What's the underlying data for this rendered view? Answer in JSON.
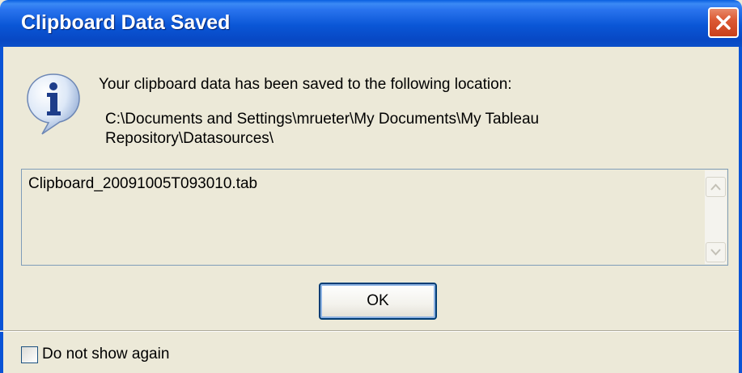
{
  "window": {
    "title": "Clipboard Data Saved",
    "close_icon": "close-icon"
  },
  "dialog": {
    "icon": "info-icon",
    "message": "Your clipboard data has been saved to the following location:",
    "path_line1": "C:\\Documents and Settings\\mrueter\\My Documents\\My Tableau",
    "path_line2": "Repository\\Datasources\\",
    "file_name": "Clipboard_20091005T093010.tab",
    "ok_label": "OK",
    "checkbox_label": "Do not show again",
    "checkbox_checked": false
  },
  "colors": {
    "titlebar": "#0a56d6",
    "close_button": "#dc5a34",
    "dialog_background": "#ece9d8",
    "button_border": "#003c74"
  }
}
